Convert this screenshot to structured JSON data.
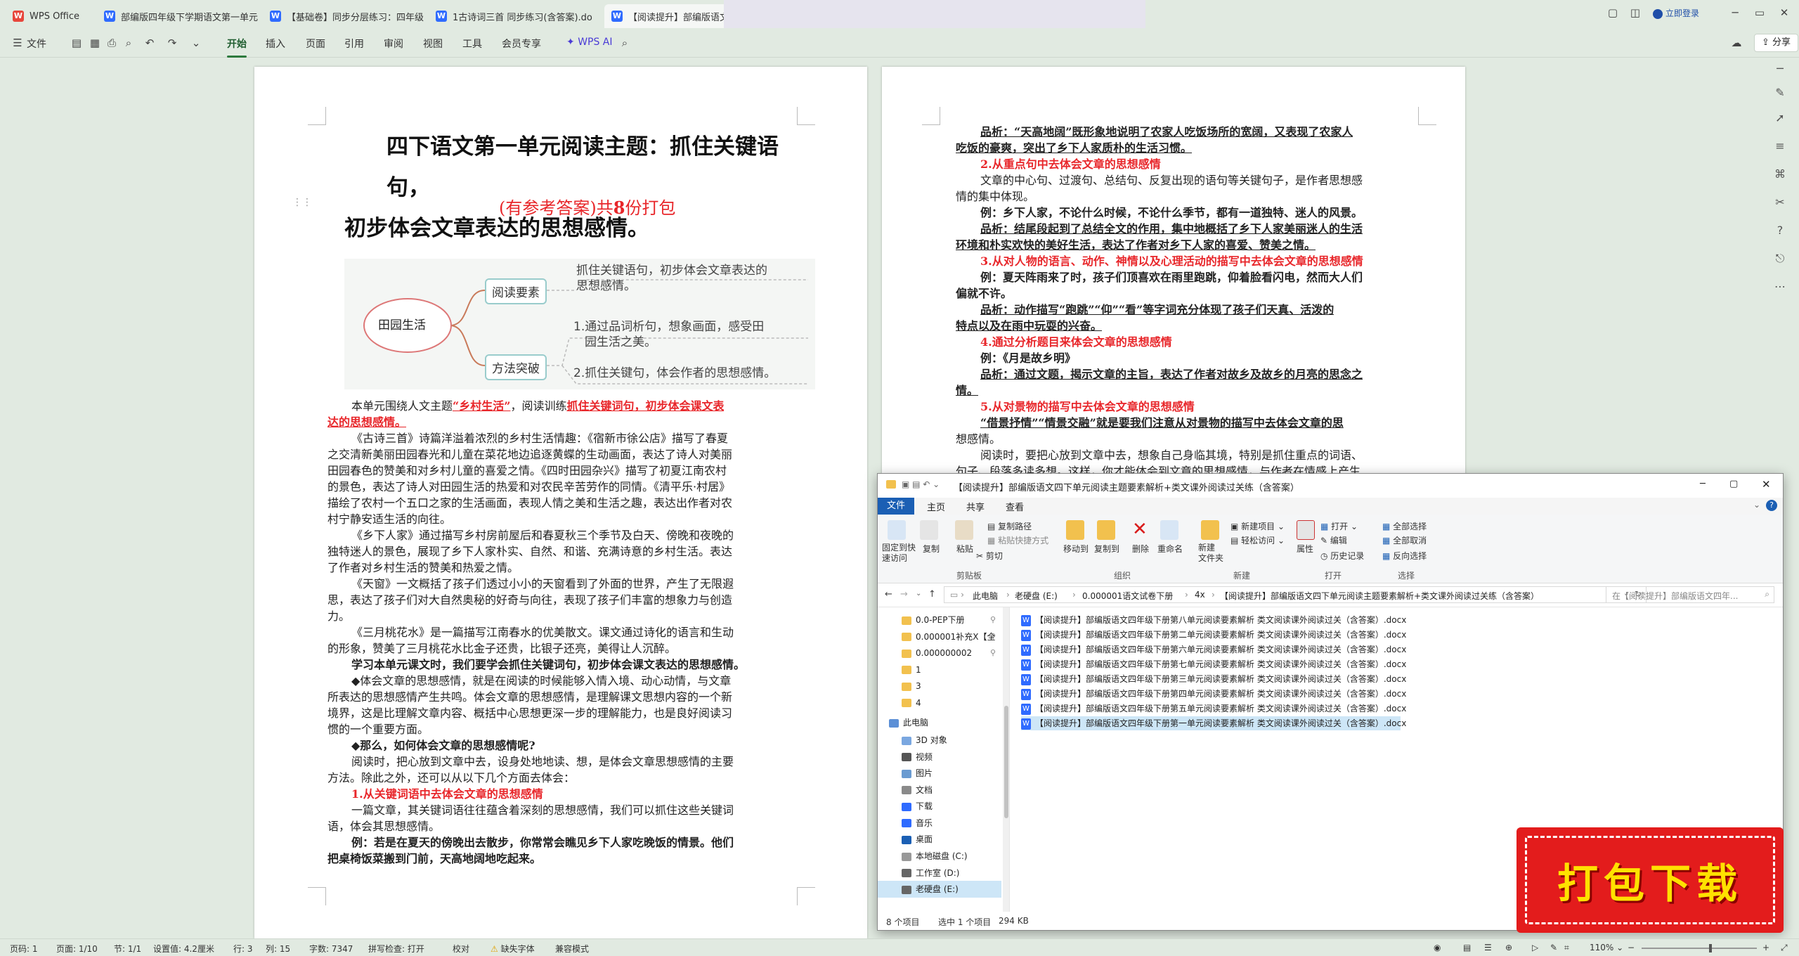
{
  "titlebar": {
    "tabs": [
      {
        "label": "WPS Office"
      },
      {
        "label": "部编版四年级下学期语文第一单元"
      },
      {
        "label": "【基础卷】同步分层练习：四年级"
      },
      {
        "label": "1古诗词三首 同步练习(含答案).do"
      },
      {
        "label": "【阅读提升】部编版语文四年"
      }
    ],
    "login": "立即登录"
  },
  "menubar": {
    "file": "文件",
    "items": [
      "开始",
      "插入",
      "页面",
      "引用",
      "审阅",
      "视图",
      "工具",
      "会员专享"
    ],
    "wps_ai": "WPS AI",
    "share": "分享"
  },
  "doc_left": {
    "title_line1": "四下语文第一单元阅读主题：抓住关键语句，",
    "title_line2": "初步体会文章表达的思想感情。",
    "subtitle_a": "(有参考答案)共",
    "subtitle_num": "8",
    "subtitle_b": "份打包",
    "mindmap": {
      "center": "田园生活",
      "node1": "阅读要素",
      "node2": "方法突破",
      "text1a": "抓住关键语句，初步体会文章表达的",
      "text1b": "思想感情。",
      "text2a": "1.通过品词析句，想象画面，感受田",
      "text2b": "园生活之美。",
      "text3": "2.抓住关键句，体会作者的思想感情。"
    },
    "para_intro_a": "本单元围绕人文主题",
    "para_intro_b": "“乡村生活”",
    "para_intro_c": "，阅读训练",
    "para_intro_d": "抓住关键词句，初步体会课文表",
    "para_intro_e": "达的思想感情。",
    "lines": [
      "《古诗三首》诗篇洋溢着浓烈的乡村生活情趣：《宿新市徐公店》描写了春夏",
      "之交清新美丽田园春光和儿童在菜花地边追逐黄蝶的生动画面，表达了诗人对美丽",
      "田园春色的赞美和对乡村儿童的喜爱之情。《四时田园杂兴》描写了初夏江南农村",
      "的景色，表达了诗人对田园生活的热爱和对农民辛苦劳作的同情。《清平乐·村居》",
      "描绘了农村一个五口之家的生活画面，表现人情之美和生活之趣，表达出作者对农",
      "村宁静安适生活的向往。",
      "《乡下人家》通过描写乡村房前屋后和春夏秋三个季节及白天、傍晚和夜晚的",
      "独特迷人的景色，展现了乡下人家朴实、自然、和谐、充满诗意的乡村生活。表达",
      "了作者对乡村生活的赞美和热爱之情。",
      "《天窗》一文概括了孩子们透过小小的天窗看到了外面的世界，产生了无限遐",
      "思，表达了孩子们对大自然奥秘的好奇与向往，表现了孩子们丰富的想象力与创造",
      "力。",
      "《三月桃花水》是一篇描写江南春水的优美散文。课文通过诗化的语言和生动",
      "的形象，赞美了三月桃花水比金子还贵，比银子还亮，美得让人沉醉。"
    ],
    "bold1": "学习本单元课文时，我们要学会抓住关键词句，初步体会课文表达的思想感情。",
    "lines2": [
      "◆体会文章的思想感情，就是在阅读的时候能够入情入境、动心动情，与文章",
      "所表达的思想感情产生共鸣。体会文章的思想感情，是理解课文思想内容的一个新",
      "境界，这是比理解文章内容、概括中心思想更深一步的理解能力，也是良好阅读习",
      "惯的一个重要方面。"
    ],
    "bold2": "◆那么，如何体会文章的思想感情呢?",
    "lines3": [
      "阅读时，把心放到文章中去，设身处地地读、想，是体会文章思想感情的主要",
      "方法。除此之外，还可以从以下几个方面去体会："
    ],
    "red1": "1.从关键词语中去体会文章的思想感情",
    "lines4": [
      "一篇文章，其关键词语往往蕴含着深刻的思想感情，我们可以抓住这些关键词",
      "语，体会其思想感情。"
    ],
    "bold3a": "例：若是在夏天的傍晚出去散步，你常常会瞧见乡下人家吃晚饭的情景。他们",
    "bold3b": "把桌椅饭菜搬到门前，天高地阔地吃起来。"
  },
  "doc_right": {
    "l1": "品析：“天高地阔”既形象地说明了农家人吃饭场所的宽阔，又表现了农家人",
    "l2": "吃饭的豪爽，突出了乡下人家质朴的生活习惯。",
    "h2": "2.从重点句中去体会文章的思想感情",
    "l3": "文章的中心句、过渡句、总结句、反复出现的语句等关键句子，是作者思想感",
    "l4": "情的集中体现。",
    "l5": "例：乡下人家，不论什么时候，不论什么季节，都有一道独特、迷人的风景。",
    "l6": "品析：结尾段起到了总结全文的作用，集中地概括了乡下人家美丽迷人的生活",
    "l7": "环境和朴实欢快的美好生活，表达了作者对乡下人家的喜爱、赞美之情。",
    "h3": "3.从对人物的语言、动作、神情以及心理活动的描写中去体会文章的思想感情",
    "l8": "例：夏天阵雨来了时，孩子们顶喜欢在雨里跑跳，仰着脸看闪电，然而大人们",
    "l9": "偏就不许。",
    "l10": "品析：动作描写“跑跳”“仰”“看”等字词充分体现了孩子们天真、活泼的",
    "l11": "特点以及在雨中玩耍的兴奋。",
    "h4": "4.通过分析题目来体会文章的思想感情",
    "l12": "例：《月是故乡明》",
    "l13": "品析：通过文题，揭示文章的主旨，表达了作者对故乡及故乡的月亮的思念之",
    "l14": "情。",
    "h5": "5.从对景物的描写中去体会文章的思想感情",
    "l15": "“借景抒情”“情景交融”就是要我们注意从对景物的描写中去体会文章的思",
    "l16": "想感情。",
    "l17": "阅读时，要把心放到文章中去，想象自己身临其境，特别是抓住重点的词语、",
    "l18": "句子、段落多读多想。这样，你才能体会到文章的思想感情，与作者在情感上产生"
  },
  "explorer": {
    "title": "【阅读提升】部编版语文四下单元阅读主题要素解析+类文课外阅读过关练（含答案）",
    "tabs": {
      "file": "文件",
      "home": "主页",
      "share": "共享",
      "view": "查看"
    },
    "ribbon": {
      "pin": "固定到快\n速访问",
      "copy": "复制",
      "paste": "粘贴",
      "copy_path": "复制路径",
      "paste_shortcut": "粘贴快捷方式",
      "cut": "剪切",
      "move_to": "移动到",
      "copy_to": "复制到",
      "delete": "删除",
      "rename": "重命名",
      "new_folder": "新建\n文件夹",
      "new_item": "新建项目",
      "easy_access": "轻松访问",
      "properties": "属性",
      "open": "打开",
      "edit": "编辑",
      "history": "历史记录",
      "select_all": "全部选择",
      "select_none": "全部取消",
      "invert": "反向选择",
      "groups": [
        "剪贴板",
        "组织",
        "新建",
        "打开",
        "选择"
      ]
    },
    "breadcrumb": [
      "此电脑",
      "老硬盘 (E:)",
      "0.000001语文试卷下册",
      "4x",
      "【阅读提升】部编版语文四下单元阅读主题要素解析+类文课外阅读过关练（含答案）"
    ],
    "search_placeholder": "在【阅读提升】部编版语文四年...",
    "nav": [
      "0.0-PEP下册",
      "0.000001补充X【全",
      "0.000000002",
      "1",
      "3",
      "4",
      "此电脑",
      "3D 对象",
      "视频",
      "图片",
      "文档",
      "下载",
      "音乐",
      "桌面",
      "本地磁盘 (C:)",
      "工作室 (D:)",
      "老硬盘 (E:)"
    ],
    "files": [
      "【阅读提升】部编版语文四年级下册第八单元阅读要素解析 类文阅读课外阅读过关（含答案）.docx",
      "【阅读提升】部编版语文四年级下册第二单元阅读要素解析 类文阅读课外阅读过关（含答案）.docx",
      "【阅读提升】部编版语文四年级下册第六单元阅读要素解析 类文阅读课外阅读过关（含答案）.docx",
      "【阅读提升】部编版语文四年级下册第七单元阅读要素解析 类文阅读课外阅读过关（含答案）.docx",
      "【阅读提升】部编版语文四年级下册第三单元阅读要素解析 类文阅读课外阅读过关（含答案）.docx",
      "【阅读提升】部编版语文四年级下册第四单元阅读要素解析 类文阅读课外阅读过关（含答案）.docx",
      "【阅读提升】部编版语文四年级下册第五单元阅读要素解析 类文阅读课外阅读过关（含答案）.docx",
      "【阅读提升】部编版语文四年级下册第一单元阅读要素解析 类文阅读课外阅读过关（含答案）.docx"
    ],
    "status": {
      "count": "8 个项目",
      "selected": "选中 1 个项目",
      "size": "294 KB"
    }
  },
  "statusbar": {
    "page": "页码: 1",
    "pages": "页面: 1/10",
    "section": "节: 1/1",
    "setting": "设置值: 4.2厘米",
    "row": "行: 3",
    "col": "列: 15",
    "words": "字数: 7347",
    "spell": "拼写检查: 打开",
    "proof": "校对",
    "font_missing": "缺失字体",
    "compat": "兼容模式",
    "zoom": "110%"
  },
  "banner": {
    "text": "打包下载"
  },
  "colors": {
    "accent": "#2d7a3e",
    "red": "#e8262a",
    "banner": "#e31c1c",
    "banner_text": "#ffe100"
  }
}
